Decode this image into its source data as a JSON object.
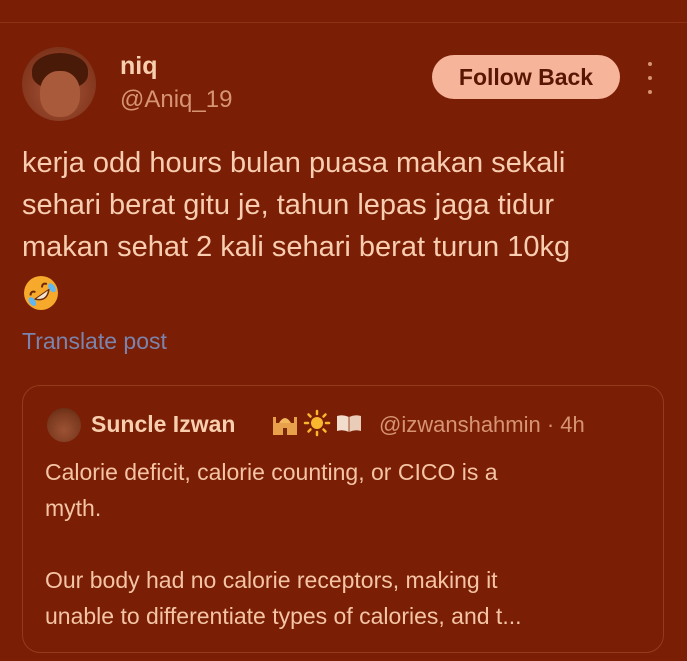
{
  "author": {
    "name": "niq",
    "handle": "@Aniq_19"
  },
  "follow_button": "Follow Back",
  "post": {
    "lines": [
      "kerja odd hours bulan puasa makan sekali",
      "sehari berat gitu je, tahun lepas jaga tidur",
      "makan sehat 2 kali sehari berat turun 10kg"
    ],
    "emoji": "rolling-on-floor-laughing-icon"
  },
  "translate_label": "Translate post",
  "quote": {
    "name": "Suncle Izwan",
    "emojis": [
      "mosque-icon",
      "sun-icon",
      "open-book-icon"
    ],
    "handle_time": "@izwanshahmin · 4h",
    "lines": [
      "Calorie deficit, calorie counting, or CICO is a",
      "myth.",
      "",
      "Our body had no calorie receptors, making it",
      "unable to differentiate types of calories, and t..."
    ]
  },
  "colors": {
    "background": "#7a1e06",
    "button_bg": "#f6b49b",
    "link": "#7b84ad"
  }
}
